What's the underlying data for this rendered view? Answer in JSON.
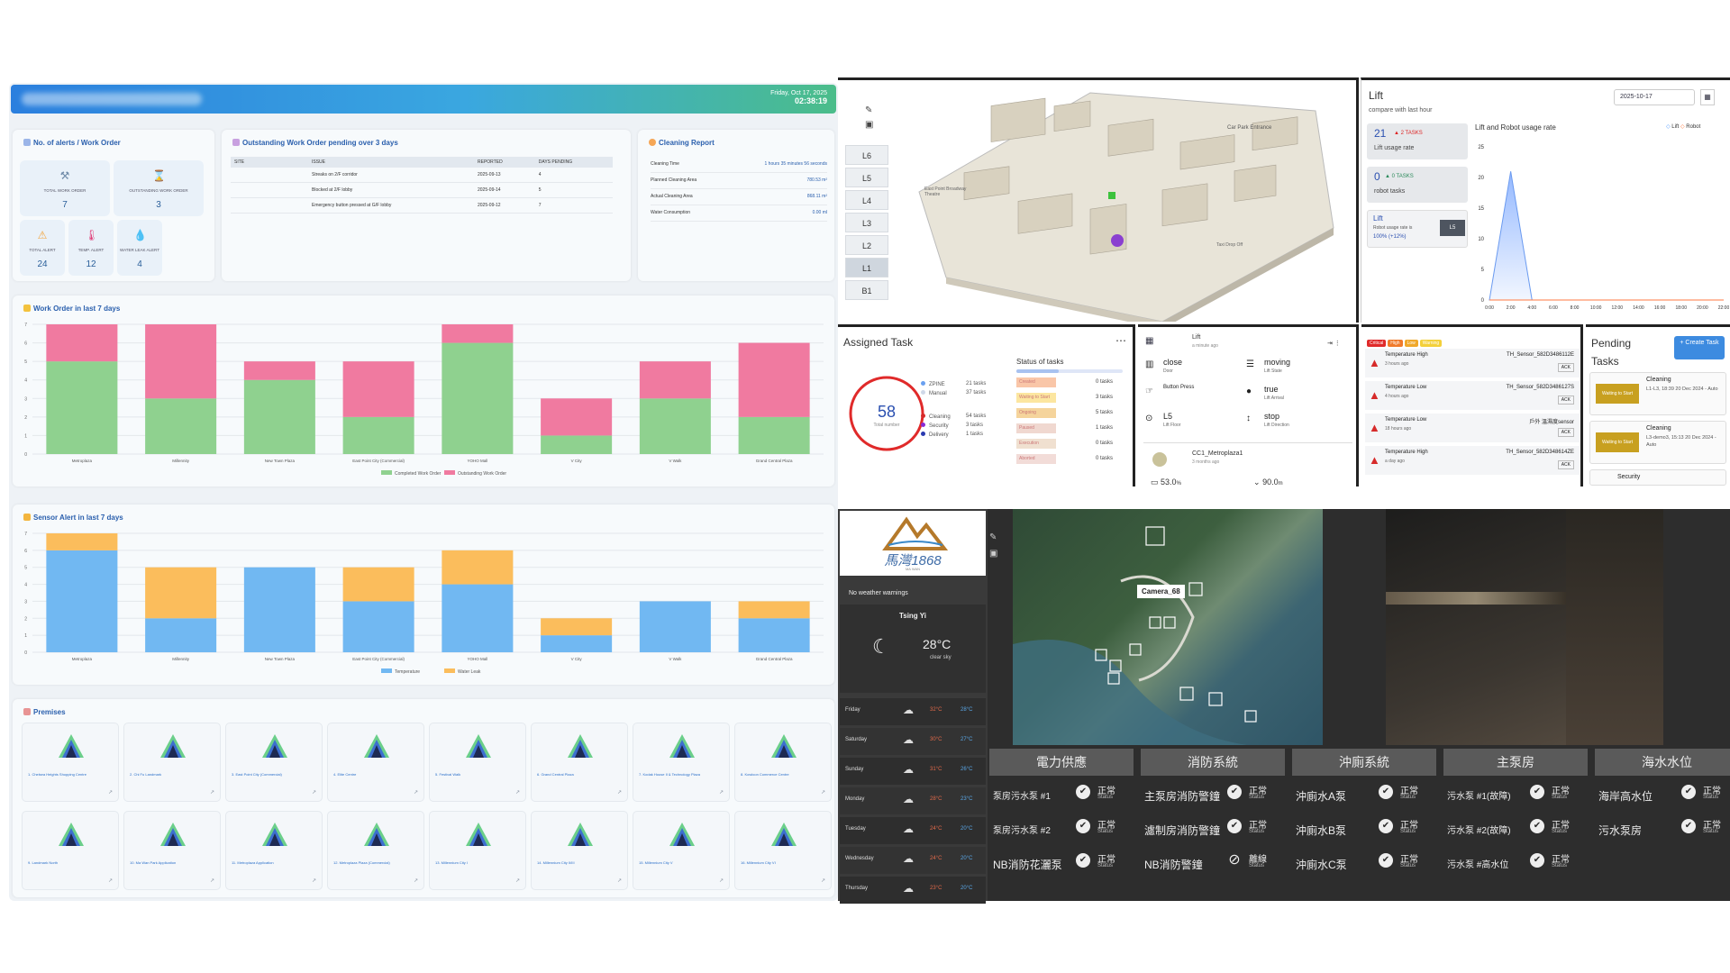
{
  "header": {
    "date": "Friday, Oct 17, 2025",
    "time": "02:38:19"
  },
  "alerts": {
    "title": "No. of alerts / Work Order",
    "items": [
      {
        "label": "TOTAL WORK ORDER",
        "value": "7",
        "icon": "hammer-icon"
      },
      {
        "label": "OUTSTANDING WORK ORDER",
        "value": "3",
        "icon": "hourglass-icon"
      },
      {
        "label": "TOTAL ALERT",
        "value": "24",
        "icon": "warning-icon"
      },
      {
        "label": "TEMP. ALERT",
        "value": "12",
        "icon": "thermometer-icon"
      },
      {
        "label": "WATER LEAK ALERT",
        "value": "4",
        "icon": "water-drop-icon"
      }
    ]
  },
  "outstanding": {
    "title": "Outstanding Work Order pending over 3 days",
    "columns": [
      "SITE",
      "ISSUE",
      "REPORTED",
      "DAYS PENDING"
    ],
    "rows": [
      [
        "",
        "Streaks on 2/F corridor",
        "2025-09-13",
        "4"
      ],
      [
        "",
        "Blocked at 2/F lobby",
        "2025-09-14",
        "5"
      ],
      [
        "",
        "Emergency button pressed at G/F lobby",
        "2025-09-12",
        "7"
      ]
    ]
  },
  "cleaning": {
    "title": "Cleaning Report",
    "rows": [
      {
        "label": "Cleaning Time",
        "value": "1 hours 35 minutes 56 seconds"
      },
      {
        "label": "Planned Cleaning Area",
        "value": "780.53 m²"
      },
      {
        "label": "Actual Cleaning Area",
        "value": "868.11 m²"
      },
      {
        "label": "Water Consumption",
        "value": "0.00 ml"
      }
    ]
  },
  "wo_chart": {
    "title": "Work Order in last 7 days",
    "legend": [
      "Completed Work Order",
      "Outstanding Work Order"
    ],
    "colors": [
      "#8fd18f",
      "#f07aa0"
    ]
  },
  "sensor_chart": {
    "title": "Sensor Alert in last 7 days",
    "legend": [
      "Temperature",
      "Water Leak"
    ],
    "colors": [
      "#71b8f2",
      "#fbbd5c"
    ]
  },
  "chart_data": [
    {
      "type": "bar",
      "title": "Work Order in last 7 days",
      "categories": [
        "Metroplaza",
        "Millennity",
        "New Town Plaza",
        "East Point City (Commercial)",
        "YOHO Mall",
        "V City",
        "V Walk",
        "Grand Central Plaza"
      ],
      "series": [
        {
          "name": "Completed Work Order",
          "values": [
            5,
            3,
            4,
            2,
            6,
            1,
            3,
            2
          ]
        },
        {
          "name": "Outstanding Work Order",
          "values": [
            2,
            4,
            1,
            3,
            1,
            2,
            2,
            4
          ]
        }
      ],
      "ylim": [
        0,
        7
      ],
      "stacked": true
    },
    {
      "type": "bar",
      "title": "Sensor Alert in last 7 days",
      "categories": [
        "Metroplaza",
        "Millennity",
        "New Town Plaza",
        "East Point City (Commercial)",
        "YOHO Mall",
        "V City",
        "V Walk",
        "Grand Central Plaza"
      ],
      "series": [
        {
          "name": "Temperature",
          "values": [
            6,
            2,
            5,
            3,
            4,
            1,
            3,
            2
          ]
        },
        {
          "name": "Water Leak",
          "values": [
            1,
            3,
            0,
            2,
            2,
            1,
            0,
            1
          ]
        }
      ],
      "ylim": [
        0,
        7
      ],
      "stacked": true
    },
    {
      "type": "area",
      "title": "Lift and Robot usage rate",
      "x": [
        "0:00",
        "2:00",
        "4:00",
        "6:00",
        "8:00",
        "10:00",
        "12:00",
        "14:00",
        "16:00",
        "18:00",
        "20:00",
        "22:00"
      ],
      "series": [
        {
          "name": "Lift",
          "values": [
            0,
            21,
            0,
            0,
            0,
            0,
            0,
            0,
            0,
            0,
            0,
            0
          ]
        },
        {
          "name": "Robot",
          "values": [
            0,
            0,
            0,
            0,
            0,
            0,
            0,
            0,
            0,
            0,
            0,
            0
          ]
        }
      ],
      "ylim": [
        0,
        25
      ]
    }
  ],
  "premises": {
    "title": "Premises",
    "items": [
      "1. Chelsea Heights Shopping Centre",
      "2. Chi Fu Landmark",
      "3. East Point City (Commercial)",
      "4. Elite Centre",
      "5. Festival Walk",
      "6. Grand Central Plaza",
      "7. Kodak House II & Technology Plaza",
      "8. Kowloon Commerce Centre",
      "9. Landmark North",
      "10. Ma Wan Park Application",
      "11. Metroplaza Application",
      "12. Metroplaza Plaza (Commercial)",
      "13. Millennium City I",
      "14. Millennium City II/III",
      "15. Millennium City V",
      "16. Millennium City VI"
    ]
  },
  "map3d": {
    "floors": [
      "L6",
      "L5",
      "L4",
      "L3",
      "L2",
      "L1",
      "B1"
    ],
    "active": "L1",
    "labels": [
      "Car Park Entrance",
      "East Point Broadway Theatre",
      "Taxi Drop Off"
    ]
  },
  "lift": {
    "title": "Lift",
    "subtitle": "compare with last hour",
    "date": "2025-10-17",
    "stat1_value": "21",
    "stat1_badge": "▲ 2 TASKS",
    "stat1_label": "Lift usage rate",
    "stat2_value": "0",
    "stat2_badge": "▲ 0 TASKS",
    "stat2_label": "robot tasks",
    "stat3_title": "Lift",
    "stat3_label": "Robot usage rate is",
    "stat3_value": "100% (+12%)",
    "stat3_floor": "L5",
    "chart_title": "Lift and Robot usage rate",
    "legend": [
      "Lift",
      "Robot"
    ],
    "yticks": [
      "25",
      "20",
      "15",
      "10",
      "5",
      "0"
    ]
  },
  "assigned": {
    "title": "Assigned Task",
    "total": "58",
    "total_label": "Total number",
    "menu": "⋯",
    "status_title": "Status of tasks",
    "types": [
      [
        "ZPINE",
        "21 tasks"
      ],
      [
        "Manual",
        "37 tasks"
      ]
    ],
    "cats": [
      [
        "Cleaning",
        "54 tasks"
      ],
      [
        "Security",
        "3 tasks"
      ],
      [
        "Delivery",
        "1 tasks"
      ]
    ],
    "statuses": [
      [
        "Created",
        "0 tasks"
      ],
      [
        "Waiting to Start",
        "3 tasks"
      ],
      [
        "Ongoing",
        "5 tasks"
      ],
      [
        "Paused",
        "1 tasks"
      ],
      [
        "Execution",
        "0 tasks"
      ],
      [
        "Aborted",
        "0 tasks"
      ]
    ]
  },
  "liftstate": {
    "title": "Lift",
    "ago": "a minute ago",
    "items": [
      [
        "close",
        "Door"
      ],
      [
        "moving",
        "Lift State"
      ],
      [
        "Button Press",
        ""
      ],
      [
        "true",
        "Lift Arrival"
      ],
      [
        "L5",
        "Lift Floor"
      ],
      [
        "stop",
        "Lift Direction"
      ]
    ],
    "robot": "CC1_Metroplaza1",
    "robot_ago": "3 months ago",
    "battery": "53.0",
    "battery_unit": "%",
    "dist": "90.0",
    "dist_unit": "m"
  },
  "alertlist": {
    "tags": [
      "Critical",
      "High",
      "Low",
      "Warning"
    ],
    "items": [
      [
        "Temperature High",
        "3 hours ago",
        "TH_Sensor_582D3486112E",
        "ACK"
      ],
      [
        "Temperature Low",
        "4 hours ago",
        "TH_Sensor_582D3486127S",
        "ACK"
      ],
      [
        "Temperature Low",
        "18 hours ago",
        "戶外 溫濕度sensor",
        "ACK"
      ],
      [
        "Temperature High",
        "a day ago",
        "TH_Sensor_582D348614ZE",
        "ACK"
      ]
    ]
  },
  "pending": {
    "title": "Pending Tasks",
    "create": "+ Create Task",
    "items": [
      [
        "Cleaning",
        "L1-L3, 18:39 20 Dec 2024 - Auto",
        "Waiting to Start"
      ],
      [
        "Cleaning",
        "L3-demo3, 15:13 20 Dec 2024 - Auto",
        "Waiting to Start"
      ],
      [
        "Security",
        "",
        ""
      ]
    ]
  },
  "weather": {
    "brand": "馬灣1868",
    "brand_sub": "MA WAN",
    "warning": "No weather warnings",
    "place": "Tsing Yi",
    "temp": "28°C",
    "cond": "clear sky",
    "days": [
      [
        "Friday",
        "32°C",
        "28°C"
      ],
      [
        "Saturday",
        "30°C",
        "27°C"
      ],
      [
        "Sunday",
        "31°C",
        "26°C"
      ],
      [
        "Monday",
        "28°C",
        "23°C"
      ],
      [
        "Tuesday",
        "24°C",
        "20°C"
      ],
      [
        "Wednesday",
        "24°C",
        "20°C"
      ],
      [
        "Thursday",
        "23°C",
        "20°C"
      ]
    ]
  },
  "camera": {
    "label": "Camera_68"
  },
  "systems": {
    "headers": [
      "電力供應",
      "消防系統",
      "沖廁系統",
      "主泵房",
      "海水水位"
    ],
    "cols": [
      [
        [
          "泵房污水泵 #1",
          "正常",
          "Status"
        ],
        [
          "泵房污水泵 #2",
          "正常",
          "Status"
        ],
        [
          "NB消防花灑泵",
          "正常",
          "Status"
        ]
      ],
      [
        [
          "主泵房消防警鐘",
          "正常",
          "Status"
        ],
        [
          "濾制房消防警鐘",
          "正常",
          "Status"
        ],
        [
          "NB消防警鐘",
          "離線",
          "Status"
        ]
      ],
      [
        [
          "沖廁水A泵",
          "正常",
          "Status"
        ],
        [
          "沖廁水B泵",
          "正常",
          "Status"
        ],
        [
          "沖廁水C泵",
          "正常",
          "Status"
        ]
      ],
      [
        [
          "污水泵 #1(故障)",
          "正常",
          "Status"
        ],
        [
          "污水泵 #2(故障)",
          "正常",
          "Status"
        ],
        [
          "污水泵 #高水位",
          "正常",
          "Status"
        ]
      ],
      [
        [
          "海岸高水位",
          "正常",
          "Status"
        ],
        [
          "污水泵房",
          "正常",
          "Status"
        ]
      ]
    ]
  }
}
